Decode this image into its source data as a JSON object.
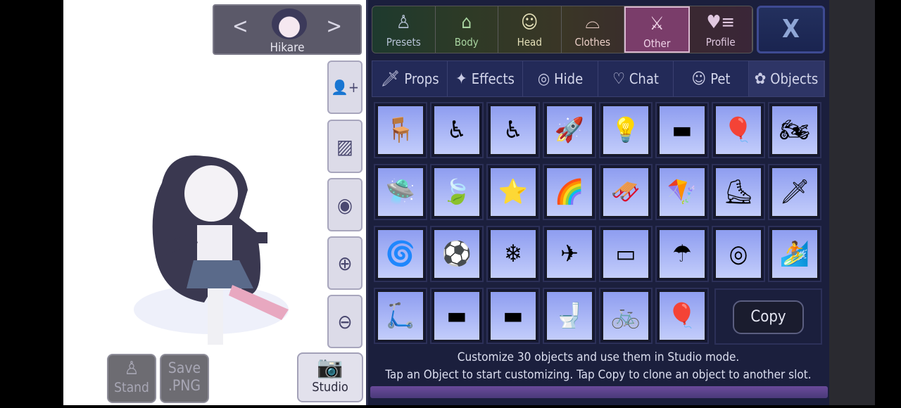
{
  "character": {
    "name": "Hikare"
  },
  "side_buttons": [
    {
      "icon": "add-person-icon",
      "glyph": "👤+"
    },
    {
      "icon": "background-image-icon",
      "glyph": "▨"
    },
    {
      "icon": "eye-icon",
      "glyph": "◉"
    },
    {
      "icon": "zoom-in-icon",
      "glyph": "⊕"
    },
    {
      "icon": "zoom-out-icon",
      "glyph": "⊖"
    }
  ],
  "bottom": {
    "stand": "Stand",
    "save1": "Save",
    "save2": ".PNG",
    "studio": "Studio"
  },
  "top_tabs": [
    {
      "label": "Presets",
      "glyph": "♙",
      "color": "#b8c4d8"
    },
    {
      "label": "Body",
      "glyph": "⌂",
      "color": "#a8d4a0"
    },
    {
      "label": "Head",
      "glyph": "☺",
      "color": "#e4e0b8"
    },
    {
      "label": "Clothes",
      "glyph": "⌓",
      "color": "#ecd0c8"
    },
    {
      "label": "Other",
      "glyph": "⚔",
      "color": "#f0d4e8",
      "active": true
    },
    {
      "label": "Profile",
      "glyph": "♥≡",
      "color": "#e0c8e0"
    }
  ],
  "close": "X",
  "sub_tabs": [
    {
      "label": "Props",
      "glyph": "🗡"
    },
    {
      "label": "Effects",
      "glyph": "✦"
    },
    {
      "label": "Hide",
      "glyph": "◎"
    },
    {
      "label": "Chat",
      "glyph": "♡"
    },
    {
      "label": "Pet",
      "glyph": "☺"
    },
    {
      "label": "Objects",
      "glyph": "✿",
      "active": true
    }
  ],
  "objects": [
    "🪑",
    "♿",
    "♿",
    "🚀",
    "💡",
    "▬",
    "🎈",
    "🏍",
    "🛸",
    "🍃",
    "⭐",
    "🌈",
    "🛷",
    "🪁",
    "⛸",
    "🗡",
    "🌀",
    "⚽",
    "❄",
    "✈",
    "▭",
    "☂",
    "◎",
    "🏄",
    "🛴",
    "▬",
    "▬",
    "🚽",
    "🚲",
    "🎈"
  ],
  "copy": "Copy",
  "footer": {
    "line1": "Customize 30 objects and use them in Studio mode.",
    "line2": "Tap an Object to start customizing. Tap Copy to clone an object to another slot."
  }
}
